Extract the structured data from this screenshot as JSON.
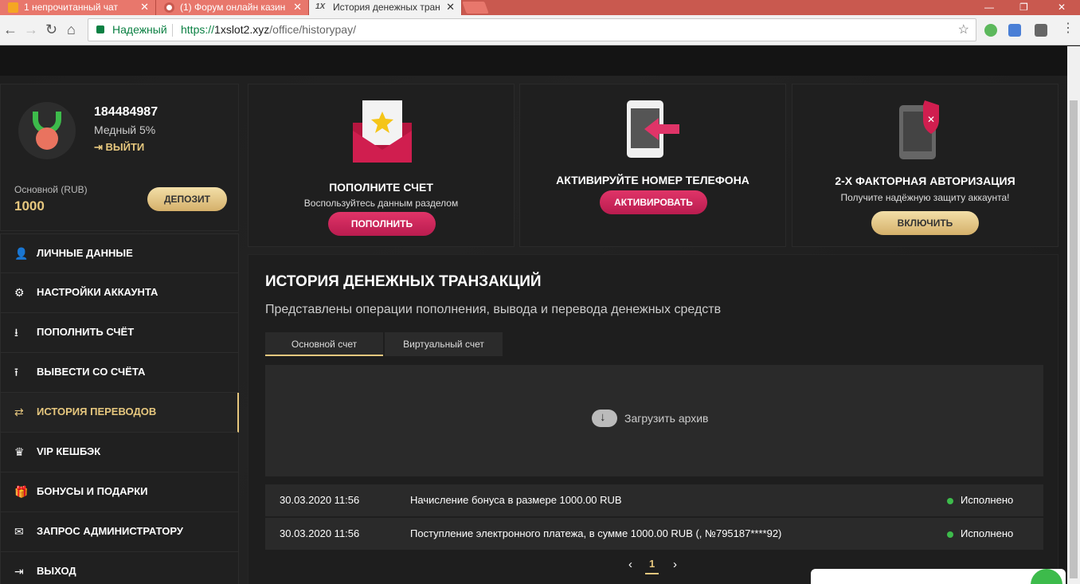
{
  "browser": {
    "tabs": [
      {
        "title": "1 непрочитанный чат",
        "icon": "mail-icon"
      },
      {
        "title": "(1) Форум онлайн казин",
        "icon": "forum-icon"
      },
      {
        "title": "История денежных тран",
        "icon": "1x-icon"
      }
    ],
    "secure_label": "Надежный",
    "url_scheme": "https://",
    "url_host": "1xslot2.xyz",
    "url_path": "/office/historypay/"
  },
  "profile": {
    "user_id": "184484987",
    "level": "Медный 5%",
    "logout": "ВЫЙТИ",
    "account_label": "Основной (RUB)",
    "balance": "1000",
    "deposit_button": "ДЕПОЗИТ"
  },
  "menu": [
    {
      "label": "ЛИЧНЫЕ ДАННЫЕ",
      "icon": "user-plus-icon"
    },
    {
      "label": "НАСТРОЙКИ АККАУНТА",
      "icon": "gears-icon"
    },
    {
      "label": "ПОПОЛНИТЬ СЧЁТ",
      "icon": "download-icon"
    },
    {
      "label": "ВЫВЕСТИ СО СЧЁТА",
      "icon": "upload-icon"
    },
    {
      "label": "ИСТОРИЯ ПЕРЕВОДОВ",
      "icon": "transfer-icon",
      "active": true
    },
    {
      "label": "VIP КЕШБЭК",
      "icon": "crown-icon"
    },
    {
      "label": "БОНУСЫ И ПОДАРКИ",
      "icon": "gift-icon"
    },
    {
      "label": "ЗАПРОС АДМИНИСТРАТОРУ",
      "icon": "envelope-icon"
    },
    {
      "label": "ВЫХОД",
      "icon": "logout-icon"
    }
  ],
  "promos": [
    {
      "title": "ПОПОЛНИТЕ СЧЕТ",
      "subtitle": "Воспользуйтесь данным разделом",
      "button": "ПОПОЛНИТЬ",
      "icon": "envelope-star-icon"
    },
    {
      "title": "АКТИВИРУЙТЕ НОМЕР ТЕЛЕФОНА",
      "subtitle": "",
      "button": "АКТИВИРОВАТЬ",
      "icon": "phone-arrow-icon"
    },
    {
      "title": "2-Х ФАКТОРНАЯ АВТОРИЗАЦИЯ",
      "subtitle": "Получите надёжную защиту аккаунта!",
      "button": "ВКЛЮЧИТЬ",
      "icon": "tablet-shield-icon"
    }
  ],
  "history": {
    "title": "ИСТОРИЯ ДЕНЕЖНЫХ ТРАНЗАКЦИЙ",
    "subtitle": "Представлены операции пополнения, вывода и перевода денежных средств",
    "tabs": [
      "Основной счет",
      "Виртуальный счет"
    ],
    "archive_label": "Загрузить архив",
    "rows": [
      {
        "date": "30.03.2020 11:56",
        "description": "Начисление бонуса в размере 1000.00 RUB",
        "status": "Исполнено"
      },
      {
        "date": "30.03.2020 11:56",
        "description": "Поступление электронного платежа, в сумме 1000.00 RUB (, №795187****92)",
        "status": "Исполнено"
      }
    ],
    "pager": {
      "prev": "‹",
      "current": "1",
      "next": "›"
    }
  },
  "colors": {
    "accent_gold": "#e6c77e",
    "accent_pink": "#c8235a",
    "success": "#3dbb4b"
  }
}
